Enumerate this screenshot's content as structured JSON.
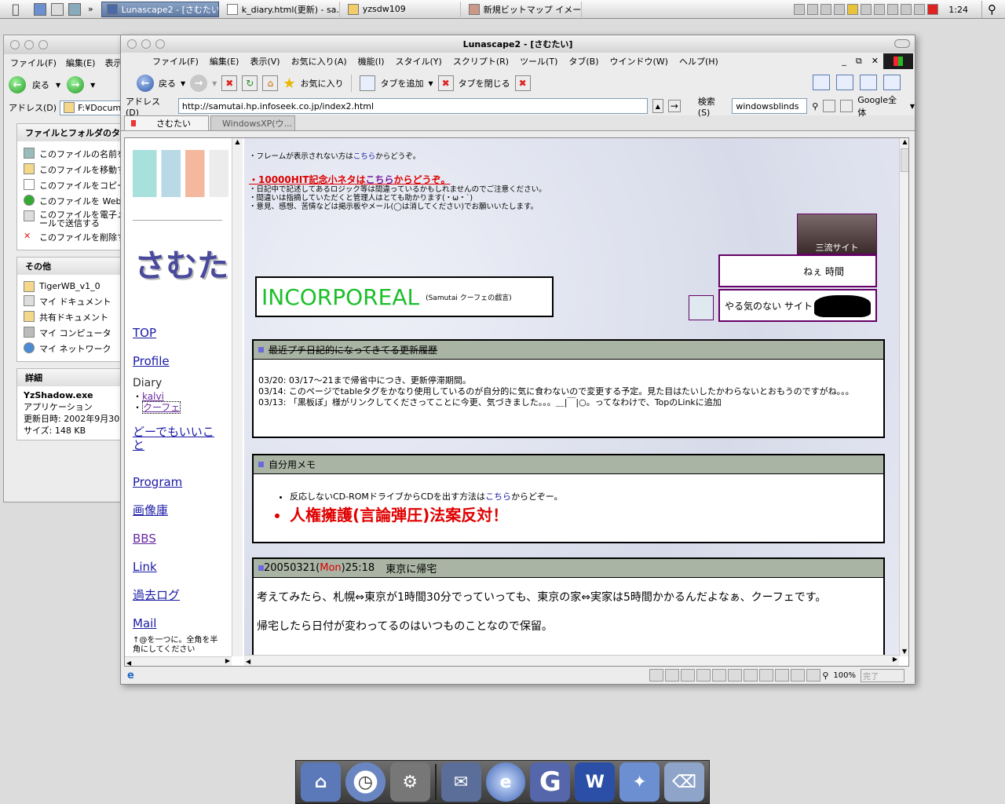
{
  "taskbar": {
    "tasks": [
      {
        "label": "Lunascape2 - [さむたい]",
        "active": true
      },
      {
        "label": "k_diary.html(更新) - sa...",
        "active": false
      },
      {
        "label": "yzsdw109",
        "active": false
      },
      {
        "label": "新規ビットマップ イメー...",
        "active": false
      }
    ],
    "clock": "1:24"
  },
  "explorer": {
    "menu": [
      "ファイル(F)",
      "編集(E)",
      "表示"
    ],
    "back_label": "戻る",
    "address_label": "アドレス(D)",
    "address_value": "F:¥Documen",
    "tasks_title": "ファイルとフォルダのタスク",
    "tasks": [
      "このファイルの名前を",
      "このファイルを移動す",
      "このファイルをコピーす",
      "このファイルを Web に",
      "このファイルを電子メールで送信する",
      "このファイルを削除す"
    ],
    "other_title": "その他",
    "other": [
      "TigerWB_v1_0",
      "マイ ドキュメント",
      "共有ドキュメント",
      "マイ コンピュータ",
      "マイ ネットワーク"
    ],
    "details_title": "詳細",
    "details": {
      "name": "YzShadow.exe",
      "type": "アプリケーション",
      "date": "更新日時: 2002年9月30",
      "size": "サイズ: 148 KB"
    }
  },
  "browser": {
    "title": "Lunascape2 - [さむたい]",
    "menu": [
      "ファイル(F)",
      "編集(E)",
      "表示(V)",
      "お気に入り(A)",
      "機能(I)",
      "スタイル(Y)",
      "スクリプト(R)",
      "ツール(T)",
      "タブ(B)",
      "ウインドウ(W)",
      "ヘルプ(H)"
    ],
    "toolbar": {
      "back": "戻る",
      "favorites": "お気に入り",
      "add_tab": "タブを追加",
      "close_tab": "タブを閉じる"
    },
    "address_label": "アドレス(D)",
    "url": "http://samutai.hp.infoseek.co.jp/index2.html",
    "search_label": "検索(S)",
    "search_value": "windowsblinds",
    "search_engine": "Google全体",
    "tabs": [
      "さむたい",
      "WindowsXP(ウ..."
    ],
    "status_zoom": "100%",
    "status_text": "完了"
  },
  "left_frame": {
    "logo": "さむたい",
    "links": [
      "TOP",
      "Profile"
    ],
    "diary_label": "Diary",
    "diary_links": [
      "kalvi",
      "クーフェ"
    ],
    "links2": [
      "どーでもいいこと",
      "Program",
      "画像庫",
      "BBS",
      "Link",
      "過去ログ",
      "Mail"
    ],
    "footer": "↑@を一つに。全角を半角にしてください"
  },
  "main_frame": {
    "frame_note_pre": "・フレームが表示されない方は",
    "frame_note_link": "こちら",
    "frame_note_post": "からどうぞ。",
    "hit_link": "・10000HIT記念小ネタは",
    "hit_link2": "こちら",
    "hit_link3": "からどうぞ。",
    "notes": [
      "・日記中で記述してあるロジック等は間違っているかもしれませんのでご注意ください。",
      "・間違いは指摘していただくと管理人はとても助かります(・ω・`)",
      "・意見、感想、苦情などは掲示板やメール(◯は消してください)でお願いいたします。"
    ],
    "banner_title": "INCORPOREAL",
    "banner_sub": "(Samutai クーフェの戯言)",
    "side_banners": [
      "三流サイト",
      "ねぇ 時間",
      "やる気のない サイト"
    ],
    "history_title": "最近プチ日記的になってきてる更新履歴",
    "history": [
      "03/20: 03/17〜21まで帰省中につき、更新停滞期間。",
      "03/14: このページでtableタグをかなり使用しているのが自分的に気に食わないので変更する予定。見た目はたいしたかわらないとおもうのですがね。。。",
      "03/13: 「黒板ぽ」様がリンクしてくださってことに今更、気づきました。。。＿|￣|○。ってなわけで、TopのLinkに追加"
    ],
    "memo_title": "自分用メモ",
    "memo_item1_pre": "反応しないCD-ROMドライブからCDを出す方法は",
    "memo_item1_link": "こちら",
    "memo_item1_post": "からどぞー。",
    "memo_item2": "人権擁護(言論弾圧)法案反対！",
    "entry_date": "20050321(",
    "entry_day": "Mon",
    "entry_time": ")25:18",
    "entry_title": "東京に帰宅",
    "entry_p1": "考えてみたら、札幌⇔東京が1時間30分でっていっても、東京の家⇔実家は5時間かかるんだよなぁ、クーフェです。",
    "entry_p2": "帰宅したら日付が変わってるのはいつものことなので保留。"
  }
}
